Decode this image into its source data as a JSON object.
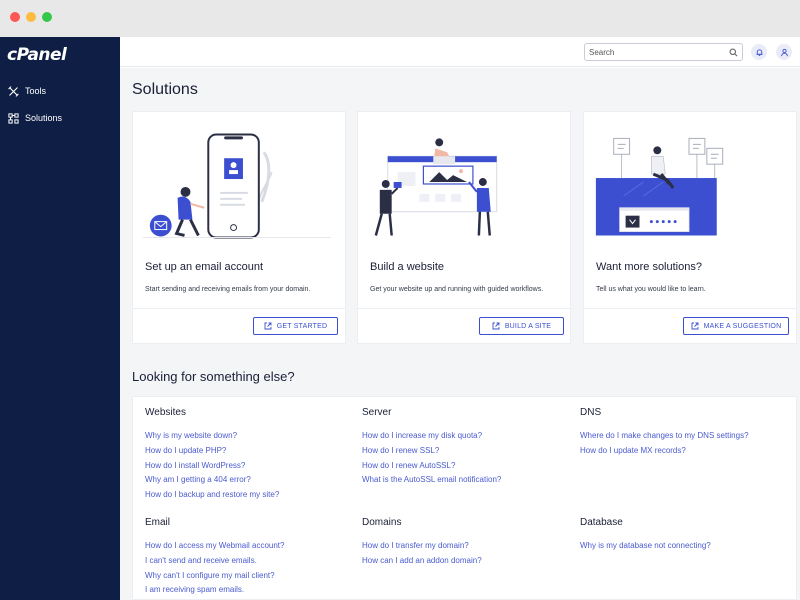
{
  "sidebar": {
    "logo": "cPanel",
    "items": [
      {
        "label": "Tools",
        "icon": "tools-icon"
      },
      {
        "label": "Solutions",
        "icon": "solutions-icon"
      }
    ]
  },
  "topbar": {
    "search_placeholder": "Search",
    "icons": [
      "search-icon",
      "bell-icon",
      "user-icon"
    ]
  },
  "main": {
    "title": "Solutions",
    "cards": [
      {
        "title": "Set up an email account",
        "description": "Start sending and receiving emails from your domain.",
        "button": "GET STARTED"
      },
      {
        "title": "Build a website",
        "description": "Get your website up and running with guided workflows.",
        "button": "BUILD A SITE"
      },
      {
        "title": "Want more solutions?",
        "description": "Tell us what you would like to learn.",
        "button": "MAKE A SUGGESTION"
      }
    ],
    "faq_title": "Looking for something else?",
    "faq": [
      {
        "heading": "Websites",
        "links": [
          "Why is my website down?",
          "How do I update PHP?",
          "How do I install WordPress?",
          "Why am I getting a 404 error?",
          "How do I backup and restore my site?"
        ]
      },
      {
        "heading": "Server",
        "links": [
          "How do I increase my disk quota?",
          "How do I renew SSL?",
          "How do I renew AutoSSL?",
          "What is the AutoSSL email notification?"
        ]
      },
      {
        "heading": "DNS",
        "links": [
          "Where do I make changes to my DNS settings?",
          "How do I update MX records?"
        ]
      },
      {
        "heading": "Email",
        "links": [
          "How do I access my Webmail account?",
          "I can't send and receive emails.",
          "Why can't I configure my mail client?",
          "I am receiving spam emails."
        ]
      },
      {
        "heading": "Domains",
        "links": [
          "How do I transfer my domain?",
          "How can I add an addon domain?"
        ]
      },
      {
        "heading": "Database",
        "links": [
          "Why is my database not connecting?"
        ]
      }
    ]
  },
  "colors": {
    "sidebar": "#0f1e44",
    "accent": "#3b4fd0",
    "link": "#4a5bcf",
    "background": "#f4f5f7"
  }
}
